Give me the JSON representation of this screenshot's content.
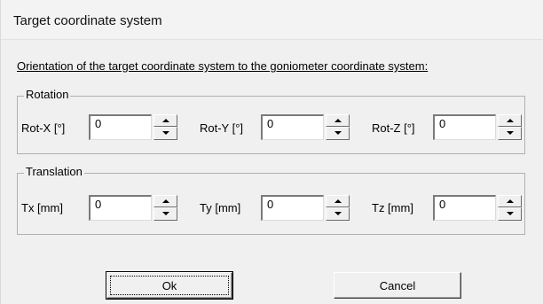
{
  "window": {
    "title": "Target coordinate system"
  },
  "heading": "Orientation of the target coordinate system to the goniometer coordinate system:",
  "rotation": {
    "legend": "Rotation",
    "fields": [
      {
        "label": "Rot-X [°]",
        "value": "0"
      },
      {
        "label": "Rot-Y [°]",
        "value": "0"
      },
      {
        "label": "Rot-Z [°]",
        "value": "0"
      }
    ]
  },
  "translation": {
    "legend": "Translation",
    "fields": [
      {
        "label": "Tx [mm]",
        "value": "0"
      },
      {
        "label": "Ty [mm]",
        "value": "0"
      },
      {
        "label": "Tz [mm]",
        "value": "0"
      }
    ]
  },
  "buttons": {
    "ok": "Ok",
    "cancel": "Cancel"
  }
}
